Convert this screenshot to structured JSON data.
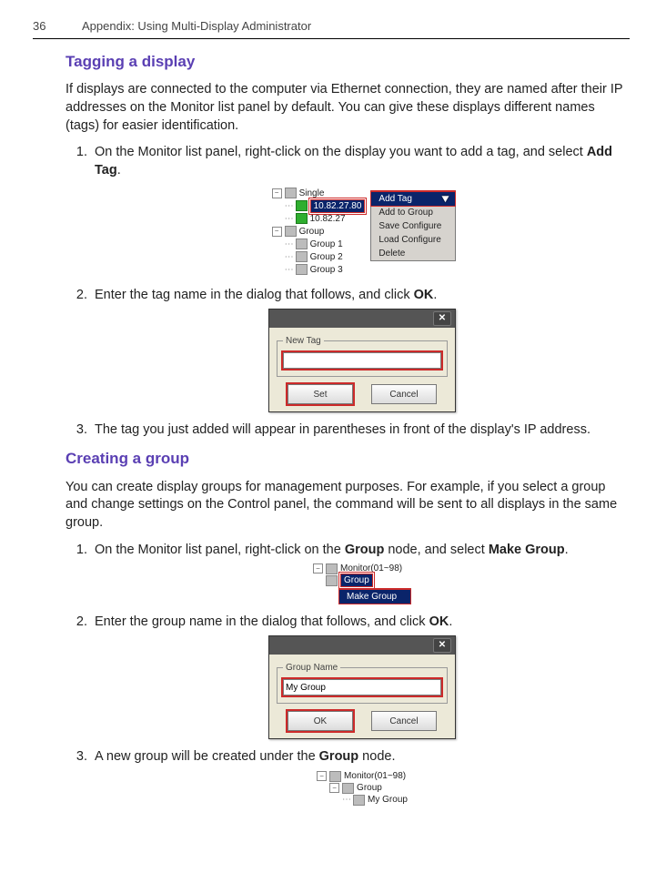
{
  "header": {
    "page_number": "36",
    "chapter": "Appendix: Using Multi-Display Administrator"
  },
  "s1": {
    "title": "Tagging a display",
    "intro": "If displays are connected to the computer via Ethernet connection, they are named after their IP addresses on the Monitor list panel by default. You can give these displays different names (tags) for easier identification.",
    "step1_a": "On the Monitor list panel, right-click on the display you want to add a tag, and select ",
    "step1_b": "Add Tag",
    "step1_c": ".",
    "step2_a": "Enter the tag name in the dialog that follows, and click ",
    "step2_b": "OK",
    "step2_c": ".",
    "step3": "The tag you just added will appear in parentheses in front of the display's IP address."
  },
  "fig1": {
    "tree": {
      "root1": "Single",
      "ip_sel": "10.82.27.80",
      "ip2": "10.82.27",
      "root2": "Group",
      "g1": "Group 1",
      "g2": "Group 2",
      "g3": "Group 3"
    },
    "menu": {
      "m1": "Add Tag",
      "m2": "Add to Group",
      "m3": "Save Configure",
      "m4": "Load Configure",
      "m5": "Delete"
    }
  },
  "fig2": {
    "legend": "New Tag",
    "value": "",
    "btn_ok": "Set",
    "btn_cancel": "Cancel"
  },
  "s2": {
    "title": "Creating a group",
    "intro": "You can create display groups for management purposes. For example, if you select a group and change settings on the Control panel, the command will be sent to all displays in the same group.",
    "step1_a": "On the Monitor list panel, right-click on the ",
    "step1_b": "Group",
    "step1_c": " node, and select ",
    "step1_d": "Make Group",
    "step1_e": ".",
    "step2_a": "Enter the group name in the dialog that follows, and click ",
    "step2_b": "OK",
    "step2_c": ".",
    "step3_a": "A new group will be created under the ",
    "step3_b": "Group",
    "step3_c": " node."
  },
  "fig3": {
    "root": "Monitor(01~98)",
    "sel": "Group",
    "menu": "Make Group"
  },
  "fig4": {
    "legend": "Group Name",
    "value": "My Group",
    "btn_ok": "OK",
    "btn_cancel": "Cancel"
  },
  "fig5": {
    "root": "Monitor(01~98)",
    "group": "Group",
    "child": "My Group"
  }
}
